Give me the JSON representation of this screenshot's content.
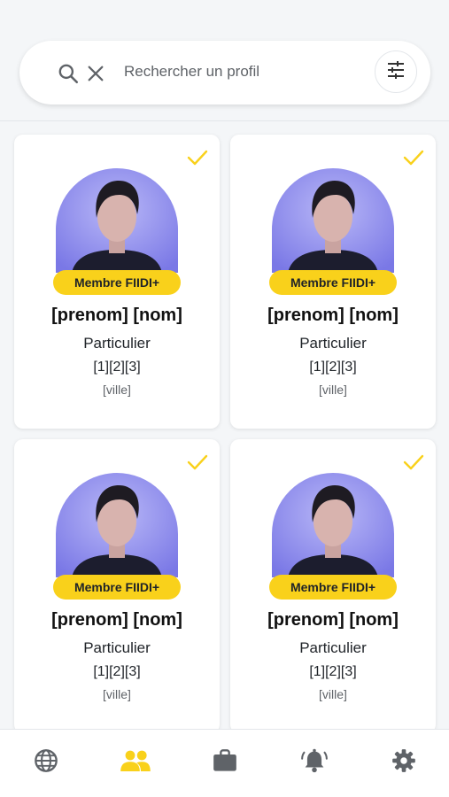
{
  "search": {
    "placeholder": "Rechercher un profil",
    "value": ""
  },
  "colors": {
    "accent": "#f9d11b",
    "background": "#f4f6f8",
    "icon_gray": "#5f6368"
  },
  "profiles": [
    {
      "badge": "Membre FIIDI+",
      "name": "[prenom] [nom]",
      "type": "Particulier",
      "tags": "[1][2][3]",
      "city": "[ville]",
      "checked": true
    },
    {
      "badge": "Membre FIIDI+",
      "name": "[prenom] [nom]",
      "type": "Particulier",
      "tags": "[1][2][3]",
      "city": "[ville]",
      "checked": true
    },
    {
      "badge": "Membre FIIDI+",
      "name": "[prenom] [nom]",
      "type": "Particulier",
      "tags": "[1][2][3]",
      "city": "[ville]",
      "checked": true
    },
    {
      "badge": "Membre FIIDI+",
      "name": "[prenom] [nom]",
      "type": "Particulier",
      "tags": "[1][2][3]",
      "city": "[ville]",
      "checked": true
    }
  ],
  "nav": {
    "items": [
      {
        "icon": "globe-icon",
        "active": false
      },
      {
        "icon": "people-icon",
        "active": true
      },
      {
        "icon": "briefcase-icon",
        "active": false
      },
      {
        "icon": "bell-icon",
        "active": false
      },
      {
        "icon": "gear-icon",
        "active": false
      }
    ]
  }
}
